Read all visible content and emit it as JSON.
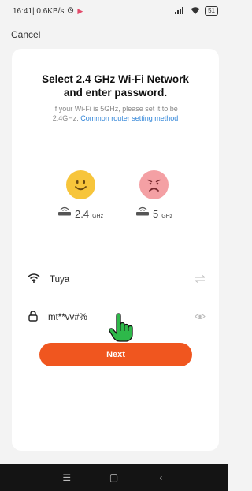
{
  "status_bar": {
    "time_speed": "16:41| 0.6KB/s",
    "alarm_icon": "alarm-clock-icon",
    "battery": "51"
  },
  "header": {
    "cancel_label": "Cancel"
  },
  "card": {
    "title_line1": "Select 2.4 GHz Wi-Fi Network",
    "title_line2": "and enter password.",
    "subtitle_line1": "If your Wi-Fi is 5GHz, please set it to be",
    "subtitle_line2_prefix": "2.4GHz. ",
    "subtitle_link": "Common router setting method",
    "band_good": {
      "num": "2.4",
      "unit": "GHz",
      "icon": "happy-face-icon"
    },
    "band_bad": {
      "num": "5",
      "unit": "GHz",
      "icon": "sad-face-icon"
    },
    "wifi_name": "Tuya",
    "password": "mt**vv#%",
    "next_label": "Next"
  },
  "colors": {
    "accent": "#f0561f",
    "link": "#2f84d8",
    "happy": "#f7c53b",
    "sad": "#f4a0a4"
  },
  "nav_bar": {
    "menu_icon": "menu-icon",
    "home_icon": "home-icon",
    "back_icon": "back-icon"
  }
}
